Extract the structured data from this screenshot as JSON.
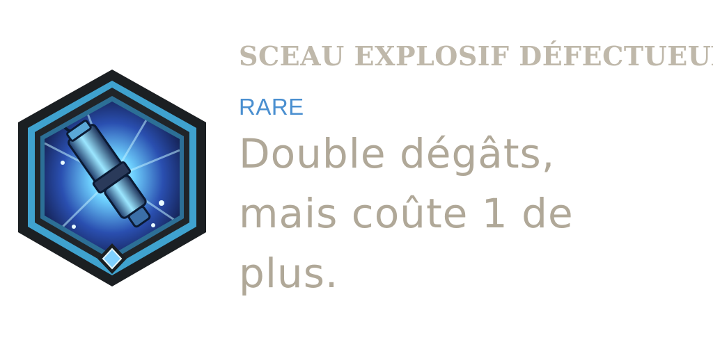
{
  "augment": {
    "title": "SCEAU EXPLOSIF DÉFECTUEUX",
    "rarity": "RARE",
    "description_lines": [
      "Double dégâts,",
      "mais coûte 1 de",
      "plus."
    ],
    "icon": "faulty-explosive-seal-icon"
  },
  "colors": {
    "title": "#bfb8aa",
    "rarity": "#4a8fd0",
    "description": "#b0a898",
    "frame_outer": "#1b1f22",
    "frame_ring": "#3fa2cf",
    "gem": "#7fd0ff"
  }
}
